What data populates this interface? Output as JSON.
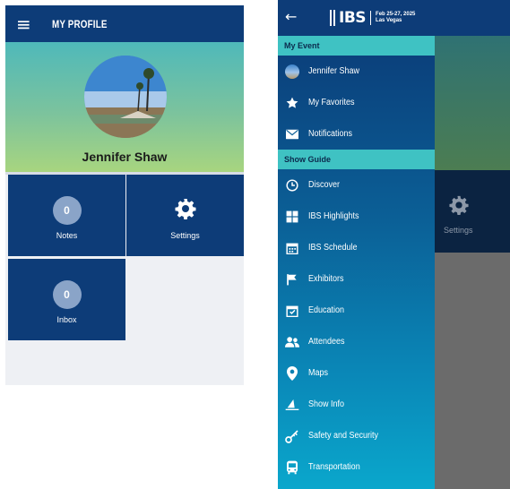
{
  "profile": {
    "title": "MY PROFILE",
    "user_name": "Jennifer Shaw",
    "tiles": [
      {
        "label": "Notes",
        "count": "0"
      },
      {
        "label": "Settings"
      },
      {
        "label": "Inbox",
        "count": "0"
      }
    ]
  },
  "drawer": {
    "logo_text": "IBS",
    "logo_dates": "Feb 25-27, 2025",
    "logo_city": "Las Vegas",
    "sections": [
      {
        "title": "My Event",
        "items": [
          {
            "label": "Jennifer Shaw",
            "icon": "avatar-icon"
          },
          {
            "label": "My Favorites",
            "icon": "star-icon"
          },
          {
            "label": "Notifications",
            "icon": "envelope-icon"
          }
        ]
      },
      {
        "title": "Show Guide",
        "items": [
          {
            "label": "Discover",
            "icon": "clock-icon"
          },
          {
            "label": "IBS Highlights",
            "icon": "grid-icon"
          },
          {
            "label": "IBS Schedule",
            "icon": "calendar-icon"
          },
          {
            "label": "Exhibitors",
            "icon": "flag-icon"
          },
          {
            "label": "Education",
            "icon": "calendar-check-icon"
          },
          {
            "label": "Attendees",
            "icon": "people-icon"
          },
          {
            "label": "Maps",
            "icon": "map-pin-icon"
          },
          {
            "label": "Show Info",
            "icon": "sail-icon"
          },
          {
            "label": "Safety and Security",
            "icon": "key-icon"
          },
          {
            "label": "Transportation",
            "icon": "bus-icon"
          }
        ]
      }
    ],
    "background_tile_label": "Settings"
  },
  "colors": {
    "navy": "#0d3c78",
    "teal_section": "#3fc2c3",
    "badge": "#8aa4c8"
  }
}
